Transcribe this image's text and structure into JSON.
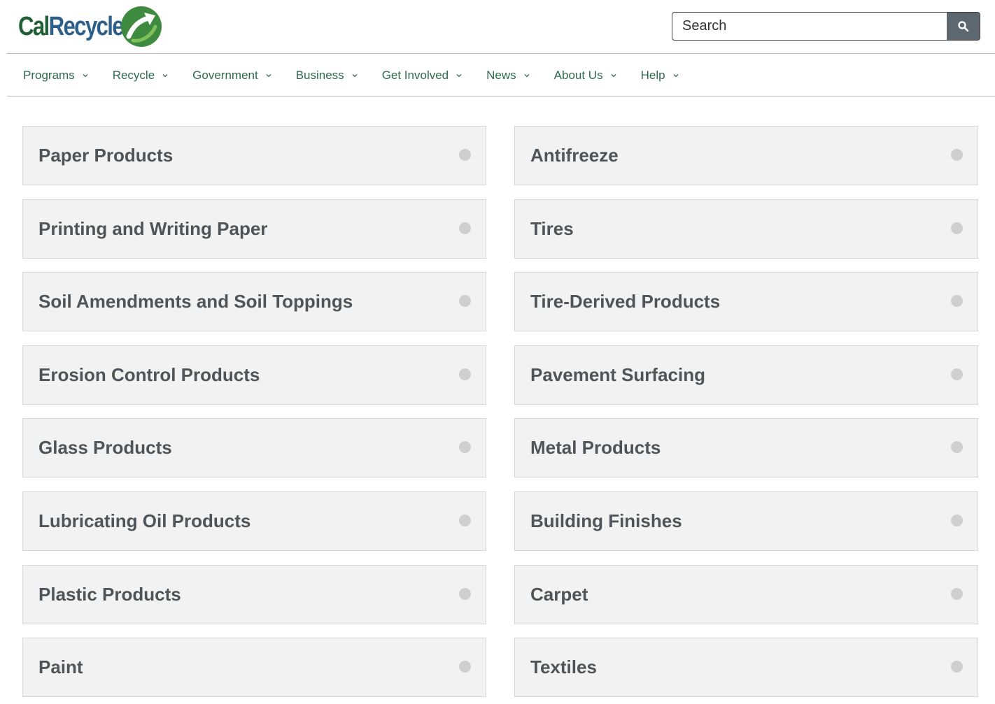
{
  "brand": {
    "name_part1": "Cal",
    "name_part2": "Recycle",
    "logo_icon": "recycle-arrow-icon"
  },
  "search": {
    "placeholder": "Search",
    "button_icon": "search-icon"
  },
  "nav": {
    "items": [
      {
        "label": "Programs"
      },
      {
        "label": "Recycle"
      },
      {
        "label": "Government"
      },
      {
        "label": "Business"
      },
      {
        "label": "Get Involved"
      },
      {
        "label": "News"
      },
      {
        "label": "About Us"
      },
      {
        "label": "Help"
      }
    ]
  },
  "categories": {
    "left": [
      "Paper Products",
      "Printing and Writing Paper",
      "Soil Amendments and Soil Toppings",
      "Erosion Control Products",
      "Glass Products",
      "Lubricating Oil Products",
      "Plastic Products",
      "Paint"
    ],
    "right": [
      "Antifreeze",
      "Tires",
      "Tire-Derived Products",
      "Pavement Surfacing",
      "Metal Products",
      "Building Finishes",
      "Carpet",
      "Textiles"
    ]
  },
  "colors": {
    "nav_text": "#2e6a4f",
    "card_bg": "#f2f2f2",
    "card_text": "#4f5458",
    "logo_green": "#1f5e34",
    "logo_blue": "#2c5f8a"
  }
}
